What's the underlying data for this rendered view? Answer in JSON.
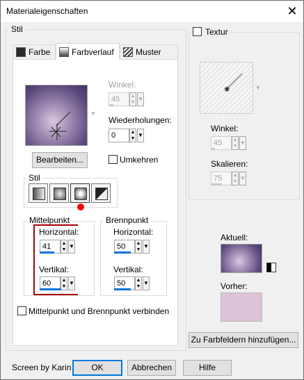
{
  "window": {
    "title": "Materialeigenschaften",
    "close_icon": "close-icon"
  },
  "stil_group": {
    "label": "Stil"
  },
  "tabs": [
    {
      "label": "Farbe",
      "icon": "color-icon"
    },
    {
      "label": "Farbverlauf",
      "icon": "gradient-icon"
    },
    {
      "label": "Muster",
      "icon": "pattern-icon"
    }
  ],
  "gradient_panel": {
    "winkel_label": "Winkel:",
    "winkel_value": "45",
    "wiederholungen_label": "Wiederholungen:",
    "wiederholungen_value": "0",
    "bearbeiten": "Bearbeiten...",
    "umkehren": "Umkehren",
    "stil_label": "Stil",
    "mittelpunkt_label": "Mittelpunkt",
    "horizontal_label": "Horizontal:",
    "horizontal_value": "41",
    "vertikal_label": "Vertikal:",
    "vertikal_value": "60",
    "brennpunkt_label": "Brennpunkt",
    "b_horizontal_label": "Horizontal:",
    "b_horizontal_value": "50",
    "b_vertikal_label": "Vertikal:",
    "b_vertikal_value": "50",
    "verbinden": "Mittelpunkt und Brennpunkt verbinden"
  },
  "texture_group": {
    "label": "Textur",
    "winkel_label": "Winkel:",
    "winkel_value": "45",
    "skalieren_label": "Skalieren:",
    "skalieren_value": "75"
  },
  "aktuell": {
    "label": "Aktuell:"
  },
  "vorher": {
    "label": "Vorher:"
  },
  "add_button": "Zu Farbfeldern hinzufügen...",
  "footer": {
    "credit": "Screen by Karin",
    "ok": "OK",
    "abbrechen": "Abbrechen",
    "hilfe": "Hilfe"
  },
  "colors": {
    "accent": "#0a74d8",
    "red": "#ff0000",
    "current_color": "#b9a8cb",
    "previous_color": "#ddc2d8"
  }
}
